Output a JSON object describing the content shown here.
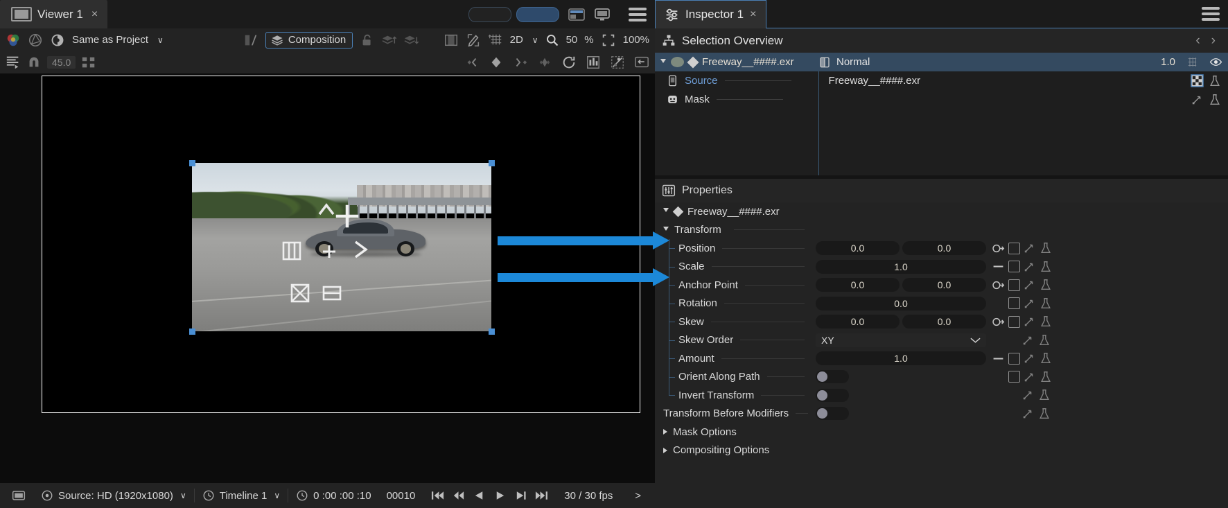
{
  "viewer": {
    "tab": {
      "label": "Viewer 1",
      "close": "×",
      "icon": "monitor-icon"
    },
    "toolbar1": {
      "color_icon": "color-wheels-icon",
      "aperture_icon": "aperture-icon",
      "lut_label": "Same as Project",
      "lut_chevron": "∨",
      "split_icon": "split-view-icon",
      "composition_label": "Composition",
      "composition_icon": "layers-icon",
      "lock_icon": "unlock-icon",
      "stack_up_icon": "stack-up-icon",
      "stack_down_icon": "stack-down-icon",
      "frame_icon": "safe-area-icon",
      "pen_icon": "pen-region-icon",
      "grid_icon": "grid-perspective-icon",
      "mode_label": "2D",
      "mode_chevron": "∨",
      "zoom_icon": "magnifier-icon",
      "zoom_value": "50",
      "zoom_unit": "%",
      "fit_icon": "fit-screen-icon",
      "scale_value": "100%"
    },
    "toolbar2": {
      "align_icon": "align-icon",
      "magnet_icon": "magnet-snap-icon",
      "angle_value": "45.0",
      "distribute_icon": "distribute-icon",
      "key_prev_icon": "prev-keyframe-icon",
      "key_add_icon": "add-keyframe-icon",
      "key_next_icon": "next-keyframe-icon",
      "key_all_icon": "all-keyframes-icon",
      "loop_icon": "loop-icon",
      "curves_icon": "curves-icon",
      "motion_blur_icon": "motion-blur-icon",
      "collapse_icon": "collapse-panel-icon"
    },
    "media": {
      "alt": "freeway-car-plate",
      "onscreen_controls": [
        "move-icon",
        "rotate-up-icon",
        "columns-icon",
        "plus-icon",
        "chevron-right-icon",
        "crop-icon",
        "rows-icon"
      ]
    },
    "statusbar": {
      "media_icon": "media-icon",
      "source_label": "Source: HD (1920x1080)",
      "source_chevron": "∨",
      "timeline_icon": "clock-icon",
      "timeline_label": "Timeline 1",
      "timeline_chevron": "∨",
      "tc_icon": "clock-icon",
      "timecode": "0 :00 :00 :10",
      "frame": "00010",
      "transport": [
        "go-start-icon",
        "step-back-fast-icon",
        "play-back-icon",
        "play-icon",
        "step-forward-icon",
        "go-end-icon"
      ],
      "fps": "30 / 30 fps",
      "expand": ">"
    },
    "top_right": {
      "pill_left": "viewer-pill-a",
      "pill_right": "viewer-pill-b",
      "layout_icon": "layout-split-icon",
      "display_icon": "display-icon",
      "menu_icon": "hamburger-menu-icon"
    }
  },
  "inspector": {
    "tab": {
      "label": "Inspector 1",
      "close": "×",
      "icon": "sliders-icon"
    },
    "menu_icon": "hamburger-menu-icon",
    "selection_overview": {
      "title": "Selection Overview",
      "icon": "node-tree-icon",
      "nav_prev": "‹",
      "nav_next": "›",
      "row": {
        "name": "Freeway__####.exr",
        "blend_mode": "Normal",
        "opacity": "1.0",
        "grid_icon": "grid-icon",
        "eye_icon": "visibility-eye-icon"
      },
      "children": [
        {
          "label": "Source",
          "value": "Freeway__####.exr",
          "icon": "source-icon",
          "right_icons": [
            "checker-icon",
            "flask-icon"
          ],
          "highlight": true
        },
        {
          "label": "Mask",
          "value": "",
          "icon": "mask-icon",
          "right_icons": [
            "keyframe-icon",
            "flask-icon"
          ],
          "highlight": false
        }
      ]
    },
    "properties": {
      "title": "Properties",
      "icon": "sliders-panel-icon",
      "root": {
        "label": "Freeway__####.exr",
        "icon": "diamond-icon",
        "expanded": true
      },
      "groups": [
        {
          "label": "Transform",
          "expanded": true,
          "rows": [
            {
              "label": "Position",
              "type": "xy",
              "values": [
                "0.0",
                "0.0"
              ],
              "icons": [
                "link-icon",
                "square-icon",
                "keyframe-icon",
                "flask-icon"
              ]
            },
            {
              "label": "Scale",
              "type": "single",
              "values": [
                "1.0"
              ],
              "icons": [
                "dash-icon",
                "square-icon",
                "keyframe-icon",
                "flask-icon"
              ]
            },
            {
              "label": "Anchor Point",
              "type": "xy",
              "values": [
                "0.0",
                "0.0"
              ],
              "icons": [
                "link-icon",
                "square-icon",
                "keyframe-icon",
                "flask-icon"
              ]
            },
            {
              "label": "Rotation",
              "type": "single",
              "values": [
                "0.0"
              ],
              "icons": [
                "blank",
                "square-icon",
                "keyframe-icon",
                "flask-icon"
              ]
            },
            {
              "label": "Skew",
              "type": "xy",
              "values": [
                "0.0",
                "0.0"
              ],
              "icons": [
                "link-icon",
                "square-icon",
                "keyframe-icon",
                "flask-icon"
              ]
            },
            {
              "label": "Skew Order",
              "type": "select",
              "values": [
                "XY"
              ],
              "icons": [
                "blank",
                "blank",
                "keyframe-icon",
                "flask-icon"
              ]
            },
            {
              "label": "Amount",
              "type": "single",
              "values": [
                "1.0"
              ],
              "icons": [
                "dash-icon",
                "square-icon",
                "keyframe-icon",
                "flask-icon"
              ]
            },
            {
              "label": "Orient Along Path",
              "type": "toggle",
              "values": [
                "off"
              ],
              "icons": [
                "blank",
                "square-icon",
                "keyframe-icon",
                "flask-icon"
              ]
            },
            {
              "label": "Invert Transform",
              "type": "toggle",
              "values": [
                "off"
              ],
              "icons": [
                "blank",
                "blank",
                "keyframe-icon",
                "flask-icon"
              ]
            }
          ]
        }
      ],
      "extra_rows": [
        {
          "label": "Transform Before Modifiers",
          "type": "toggle",
          "values": [
            "off"
          ],
          "indent": 1,
          "icons": [
            "blank",
            "blank",
            "keyframe-icon",
            "flask-icon"
          ]
        }
      ],
      "collapsed_groups": [
        {
          "label": "Mask Options"
        },
        {
          "label": "Compositing Options"
        }
      ]
    }
  },
  "annotations": {
    "accent_color": "#1c88d8",
    "arrows": [
      {
        "target": "Position"
      },
      {
        "target": "Anchor Point"
      }
    ]
  }
}
